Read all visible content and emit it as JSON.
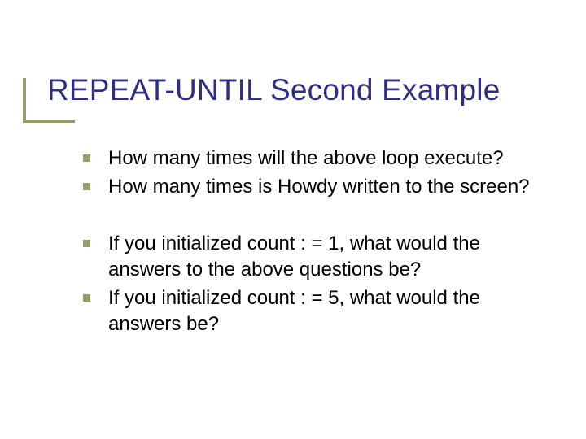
{
  "title": "REPEAT-UNTIL Second Example",
  "bullets": [
    "How many times will the above loop execute?",
    "How many times is Howdy written to the screen?",
    "If you initialized count : = 1, what would the answers to the above questions be?",
    "If you initialized count : = 5, what would the answers be?"
  ]
}
